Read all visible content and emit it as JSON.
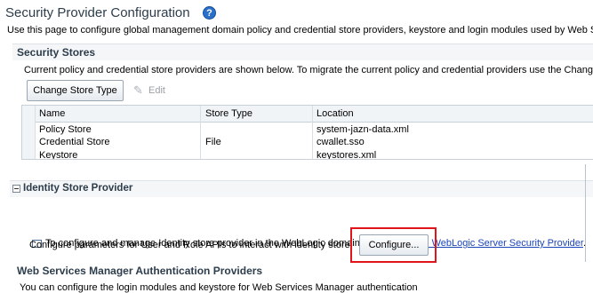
{
  "page": {
    "title": "Security Provider Configuration",
    "help_glyph": "?",
    "intro": "Use this page to configure global management domain policy and credential store providers, keystore and login modules used by Web Ser"
  },
  "security_stores": {
    "heading": "Security Stores",
    "description": "Current policy and credential store providers are shown below. To migrate the current policy and credential providers use the Change",
    "change_store_type_label": "Change Store Type",
    "edit_label": "Edit",
    "columns": [
      "Name",
      "Store Type",
      "Location"
    ],
    "rows": [
      {
        "name": "Policy Store",
        "store_type": "",
        "location": "system-jazn-data.xml"
      },
      {
        "name": "Credential Store",
        "store_type": "File",
        "location": "cwallet.sso"
      },
      {
        "name": "Keystore",
        "store_type": "",
        "location": "keystores.xml"
      }
    ]
  },
  "identity_store": {
    "heading": "Identity Store Provider",
    "manage_text": "To configure and manage Identity store provider in the WebLogic domain, use the",
    "manage_link": "Oracle WebLogic Server Security Provider",
    "manage_suffix": ".",
    "params_text": "Configure parameters for User and Role APIs to interact with identity store",
    "configure_label": "Configure..."
  },
  "wsm_auth": {
    "heading": "Web Services Manager Authentication Providers",
    "description": "You can configure the login modules and keystore for Web Services Manager authentication"
  },
  "colors": {
    "title": "#2d3d4c",
    "link": "#1b46b8",
    "highlight": "#e0151c",
    "help_icon": "#2a6fc9"
  },
  "icons": {
    "help": "help-icon",
    "edit": "pencil-icon",
    "external": "external-link-icon",
    "collapse": "collapse-minus-icon"
  }
}
